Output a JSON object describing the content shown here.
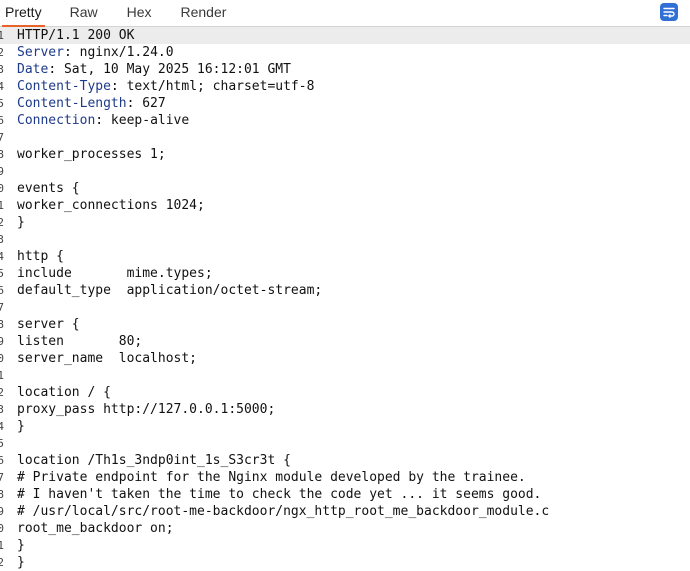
{
  "tabs": [
    "Pretty",
    "Raw",
    "Hex",
    "Render"
  ],
  "active_tab": "Pretty",
  "menu_icon": "wrap-lines-icon",
  "colors": {
    "accent": "#e8632b",
    "header_key": "#1e3a8a",
    "menu_button": "#2f6fd6"
  },
  "lines": [
    {
      "num": "1",
      "text": "HTTP/1.1 200 OK"
    },
    {
      "num": "2",
      "key": "Server",
      "value": " nginx/1.24.0"
    },
    {
      "num": "3",
      "key": "Date",
      "value": " Sat, 10 May 2025 16:12:01 GMT"
    },
    {
      "num": "4",
      "key": "Content-Type",
      "value": " text/html; charset=utf-8"
    },
    {
      "num": "5",
      "key": "Content-Length",
      "value": " 627"
    },
    {
      "num": "6",
      "key": "Connection",
      "value": " keep-alive"
    },
    {
      "num": "7",
      "text": ""
    },
    {
      "num": "8",
      "text": "worker_processes 1;"
    },
    {
      "num": "9",
      "text": ""
    },
    {
      "num": "0",
      "text": "events {"
    },
    {
      "num": "1",
      "text": "worker_connections 1024;"
    },
    {
      "num": "2",
      "text": "}"
    },
    {
      "num": "3",
      "text": ""
    },
    {
      "num": "4",
      "text": "http {"
    },
    {
      "num": "5",
      "text": "include       mime.types;"
    },
    {
      "num": "6",
      "text": "default_type  application/octet-stream;"
    },
    {
      "num": "7",
      "text": ""
    },
    {
      "num": "8",
      "text": "server {"
    },
    {
      "num": "9",
      "text": "listen       80;"
    },
    {
      "num": "0",
      "text": "server_name  localhost;"
    },
    {
      "num": "1",
      "text": ""
    },
    {
      "num": "2",
      "text": "location / {"
    },
    {
      "num": "3",
      "text": "proxy_pass http://127.0.0.1:5000;"
    },
    {
      "num": "4",
      "text": "}"
    },
    {
      "num": "5",
      "text": ""
    },
    {
      "num": "6",
      "text": "location /Th1s_3ndp0int_1s_S3cr3t {"
    },
    {
      "num": "7",
      "text": "# Private endpoint for the Nginx module developed by the trainee."
    },
    {
      "num": "8",
      "text": "# I haven't taken the time to check the code yet ... it seems good."
    },
    {
      "num": "9",
      "text": "# /usr/local/src/root-me-backdoor/ngx_http_root_me_backdoor_module.c"
    },
    {
      "num": "0",
      "text": "root_me_backdoor on;"
    },
    {
      "num": "1",
      "text": "}"
    },
    {
      "num": "2",
      "text": "}"
    }
  ]
}
